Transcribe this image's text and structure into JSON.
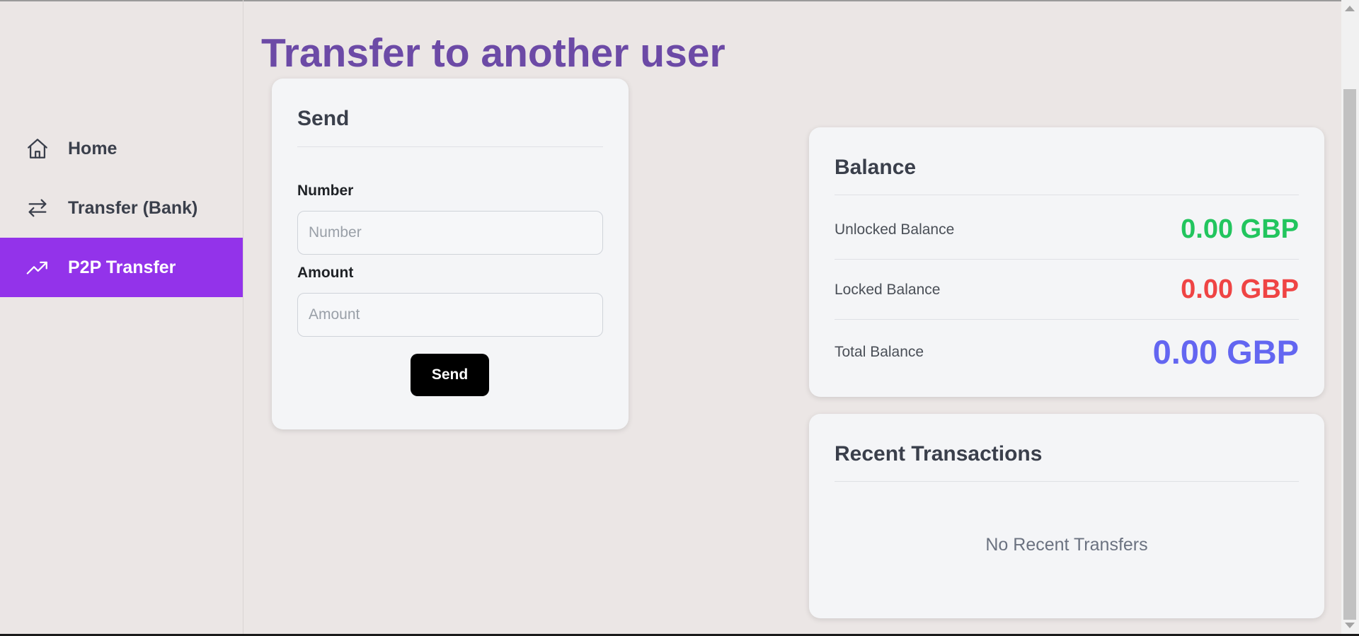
{
  "page": {
    "title": "Transfer to another user"
  },
  "sidebar": {
    "items": [
      {
        "label": "Home",
        "icon": "home-icon",
        "active": false
      },
      {
        "label": "Transfer (Bank)",
        "icon": "arrows-swap-icon",
        "active": false
      },
      {
        "label": "P2P Transfer",
        "icon": "trending-up-icon",
        "active": true
      }
    ]
  },
  "send_card": {
    "title": "Send",
    "number_label": "Number",
    "number_placeholder": "Number",
    "number_value": "",
    "amount_label": "Amount",
    "amount_placeholder": "Amount",
    "amount_value": "",
    "send_label": "Send"
  },
  "balance_card": {
    "title": "Balance",
    "rows": [
      {
        "label": "Unlocked Balance",
        "value": "0.00 GBP",
        "color": "#22c55e"
      },
      {
        "label": "Locked Balance",
        "value": "0.00 GBP",
        "color": "#ef4444"
      },
      {
        "label": "Total Balance",
        "value": "0.00 GBP",
        "color": "#6366f1"
      }
    ]
  },
  "transactions_card": {
    "title": "Recent Transactions",
    "empty_text": "No Recent Transfers"
  },
  "colors": {
    "accent": "#9333ea",
    "title": "#6c4aa6",
    "background": "#ebe6e5"
  }
}
